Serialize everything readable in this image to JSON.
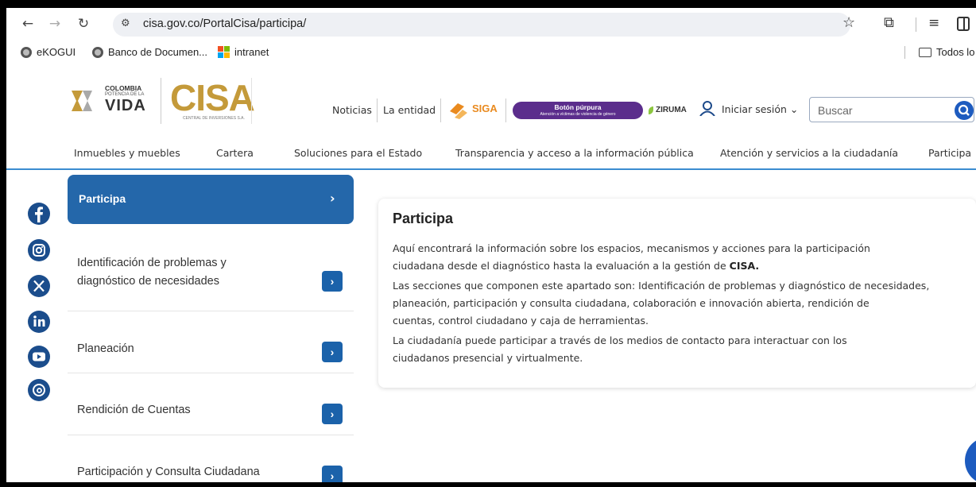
{
  "browser": {
    "url": "cisa.gov.co/PortalCisa/participa/",
    "bookmarks": [
      {
        "label": "eKOGUI"
      },
      {
        "label": "Banco de Documen..."
      },
      {
        "label": "intranet"
      }
    ],
    "bookmarks_right": "Todos lo"
  },
  "header": {
    "gov_logo": {
      "line1": "COLOMBIA",
      "line2": "POTENCIA DE LA",
      "line3": "VIDA"
    },
    "cisa_logo": {
      "text": "CISA",
      "subtitle": "CENTRAL DE INVERSIONES S.A."
    },
    "links": {
      "noticias": "Noticias",
      "entidad": "La entidad"
    },
    "siga": "SIGA",
    "purple_button": {
      "title": "Botón púrpura",
      "subtitle": "Atención a víctimas de violencia de género"
    },
    "ziruma": "ZIRUMA",
    "login": "Iniciar sesión ⌄",
    "search_placeholder": "Buscar"
  },
  "main_nav": [
    "Inmuebles y muebles",
    "Cartera",
    "Soluciones para el Estado",
    "Transparencia y acceso a la información pública",
    "Atención y servicios a la ciudadanía",
    "Participa"
  ],
  "social": [
    "facebook",
    "instagram",
    "x",
    "linkedin",
    "youtube",
    "threads"
  ],
  "menu": {
    "active": "Participa",
    "items": [
      {
        "line1": "Identificación de problemas y",
        "line2": "diagnóstico de necesidades"
      },
      {
        "line1": "Planeación"
      },
      {
        "line1": "Rendición de Cuentas"
      },
      {
        "line1": "Participación y Consulta Ciudadana"
      }
    ]
  },
  "content": {
    "title": "Participa",
    "p1_a": "Aquí encontrará la información sobre los espacios, mecanismos y acciones para la participación",
    "p1_b": "ciudadana desde el diagnóstico hasta la evaluación a la gestión de ",
    "p1_bold": "CISA.",
    "p2_a": "Las secciones que componen este apartado son: Identificación de problemas y diagnóstico de necesidades,",
    "p2_b": "planeación, participación y consulta ciudadana, colaboración e innovación abierta, rendición de",
    "p2_c": "cuentas, control ciudadano y caja de herramientas.",
    "p3_a": "La ciudadanía puede participar a través de los medios de contacto para interactuar con los",
    "p3_b": "ciudadanos presencial y virtualmente."
  },
  "colors": {
    "primary_blue": "#2467aa",
    "accent_gold": "#c49a3a",
    "purple": "#5b2d8c"
  }
}
